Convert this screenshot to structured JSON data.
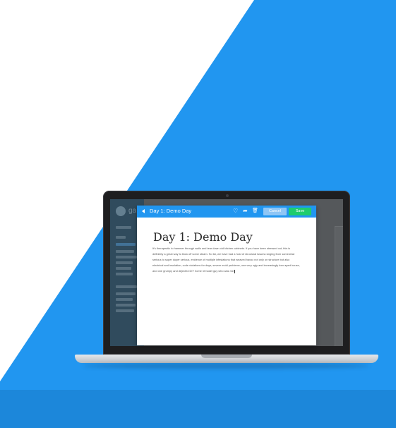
{
  "app": {
    "logo_text": "ga"
  },
  "editor": {
    "toolbar_title": "Day 1: Demo Day",
    "cancel_label": "Cancel",
    "save_label": "Save",
    "icons": [
      "back-arrow-icon",
      "heart-icon",
      "share-icon",
      "trash-icon"
    ]
  },
  "document": {
    "title": "Day 1: Demo Day",
    "body": "It's therapeutic to hammer through walls and tear down old kitchen cabinets. If you have been stressed out, this is definitely a great way to blow off some steam. So far, we have had a host of structural issues ranging from somewhat serious to super duper serious, evidence of multiple infestations that weaved havoc not only on structure but also electrical and insulation, code violations for days, severe mold problems, one very ugly and increasingly torn apart house, and one grumpy and dejected DIY home remodel guy who was me."
  },
  "colors": {
    "brand_blue": "#2196f0",
    "save_green": "#1fcc6e",
    "cancel_blue": "#8fc6f5"
  }
}
